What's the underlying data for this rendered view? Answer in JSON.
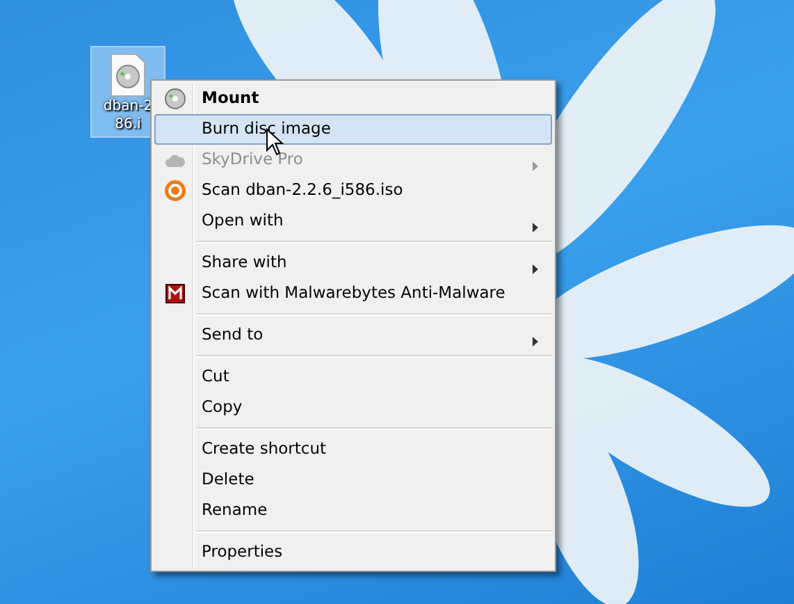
{
  "desktop_icon": {
    "label_lines": [
      "dban-2",
      "86.i"
    ],
    "selected": true
  },
  "context_menu": {
    "items": [
      {
        "kind": "disc",
        "label": "Mount",
        "default": true,
        "selected": false,
        "disabled": false,
        "submenu": false
      },
      {
        "kind": "plain",
        "label": "Burn disc image",
        "default": false,
        "selected": true,
        "disabled": false,
        "submenu": false
      },
      {
        "kind": "cloud",
        "label": "SkyDrive Pro",
        "default": false,
        "selected": false,
        "disabled": true,
        "submenu": true
      },
      {
        "kind": "scan",
        "label": "Scan dban-2.2.6_i586.iso",
        "default": false,
        "selected": false,
        "disabled": false,
        "submenu": false
      },
      {
        "kind": "plain",
        "label": "Open with",
        "default": false,
        "selected": false,
        "disabled": false,
        "submenu": true
      },
      {
        "kind": "separator"
      },
      {
        "kind": "plain",
        "label": "Share with",
        "default": false,
        "selected": false,
        "disabled": false,
        "submenu": true
      },
      {
        "kind": "malware",
        "label": "Scan with Malwarebytes Anti-Malware",
        "default": false,
        "selected": false,
        "disabled": false,
        "submenu": false
      },
      {
        "kind": "separator"
      },
      {
        "kind": "plain",
        "label": "Send to",
        "default": false,
        "selected": false,
        "disabled": false,
        "submenu": true
      },
      {
        "kind": "separator"
      },
      {
        "kind": "plain",
        "label": "Cut",
        "default": false,
        "selected": false,
        "disabled": false,
        "submenu": false
      },
      {
        "kind": "plain",
        "label": "Copy",
        "default": false,
        "selected": false,
        "disabled": false,
        "submenu": false
      },
      {
        "kind": "separator"
      },
      {
        "kind": "plain",
        "label": "Create shortcut",
        "default": false,
        "selected": false,
        "disabled": false,
        "submenu": false
      },
      {
        "kind": "plain",
        "label": "Delete",
        "default": false,
        "selected": false,
        "disabled": false,
        "submenu": false
      },
      {
        "kind": "plain",
        "label": "Rename",
        "default": false,
        "selected": false,
        "disabled": false,
        "submenu": false
      },
      {
        "kind": "separator"
      },
      {
        "kind": "plain",
        "label": "Properties",
        "default": false,
        "selected": false,
        "disabled": false,
        "submenu": false
      }
    ]
  }
}
